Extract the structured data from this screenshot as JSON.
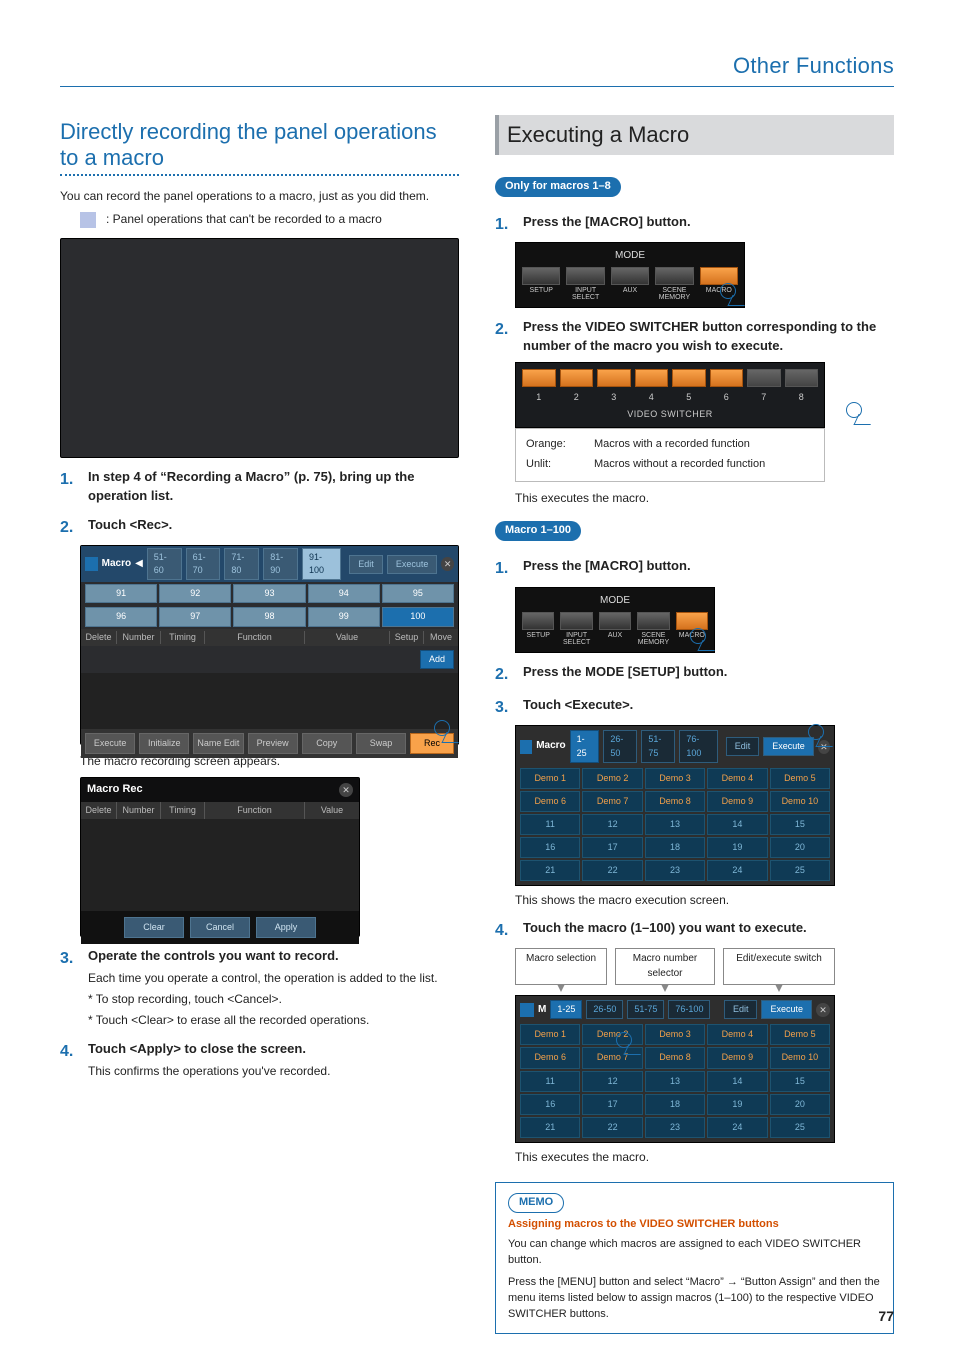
{
  "page_number": "77",
  "header": "Other Functions",
  "left": {
    "title": "Directly recording the panel operations to a macro",
    "intro": "You can record the panel operations to a macro, just as you did them.",
    "swatch_caption": ": Panel operations that can't be recorded to a macro",
    "steps": [
      {
        "num": "1.",
        "title": "In step 4 of “Recording a Macro” (p. 75), bring up the operation list."
      },
      {
        "num": "2.",
        "title": "Touch <Rec>."
      }
    ],
    "macro_list": {
      "title": "Macro",
      "arrow": "◀",
      "tabs": [
        "51-60",
        "61-70",
        "71-80",
        "81-90",
        "91-100"
      ],
      "active_tab": "91-100",
      "right_pill": "Edit",
      "right_pill2": "Execute",
      "cells_row1": [
        "91",
        "92",
        "93",
        "94",
        "95"
      ],
      "cells_row2": [
        "96",
        "97",
        "98",
        "99",
        "100"
      ],
      "cols": {
        "delete": "Delete",
        "number": "Number",
        "timing": "Timing",
        "function": "Function",
        "value": "Value",
        "setup": "Setup",
        "move": "Move"
      },
      "add_label": "Add",
      "footer": [
        "Execute",
        "Initialize",
        "Name Edit",
        "Preview",
        "Copy",
        "Swap",
        "Rec"
      ]
    },
    "after_macro_list": "The macro recording screen appears.",
    "macro_rec": {
      "title": "Macro Rec",
      "cols": {
        "delete": "Delete",
        "number": "Number",
        "timing": "Timing",
        "function": "Function",
        "value": "Value"
      },
      "footer": [
        "Clear",
        "Cancel",
        "Apply"
      ]
    },
    "step3": {
      "num": "3.",
      "title": "Operate the controls you want to record.",
      "sub": "Each time you operate a control, the operation is added to the list.",
      "b1": "*  To stop recording, touch <Cancel>.",
      "b2": "*  Touch <Clear> to erase all the recorded operations."
    },
    "step4": {
      "num": "4.",
      "title": "Touch <Apply> to close the screen.",
      "sub": "This confirms the operations you've recorded."
    }
  },
  "right": {
    "title": "Executing a Macro",
    "pill_a": "Only for macros 1–8",
    "a_steps": [
      {
        "num": "1.",
        "title": "Press the [MACRO] button."
      },
      {
        "num": "2.",
        "title": "Press the VIDEO SWITCHER button corresponding to the number of the macro you wish to execute."
      }
    ],
    "mode_panel": {
      "title": "MODE",
      "buttons": [
        "SETUP",
        "INPUT SELECT",
        "AUX",
        "SCENE MEMORY",
        "MACRO"
      ]
    },
    "switcher": {
      "numbers": [
        "1",
        "2",
        "3",
        "4",
        "5",
        "6",
        "7",
        "8"
      ],
      "sub": "VIDEO SWITCHER"
    },
    "legend": {
      "orange_k": "Orange:",
      "orange_v": "Macros with a recorded function",
      "unlit_k": "Unlit:",
      "unlit_v": "Macros without a recorded function"
    },
    "a_after": "This executes the macro.",
    "pill_b": "Macro 1–100",
    "b_steps": [
      {
        "num": "1.",
        "title": "Press the [MACRO] button."
      },
      {
        "num": "2.",
        "title": "Press the MODE [SETUP] button."
      },
      {
        "num": "3.",
        "title": "Touch <Execute>."
      }
    ],
    "macro_exec": {
      "title": "Macro",
      "tabs": [
        "1-25",
        "26-50",
        "51-75",
        "76-100"
      ],
      "active_tab": "1-25",
      "edit": "Edit",
      "execute": "Execute",
      "rows": [
        [
          "Demo 1",
          "Demo 2",
          "Demo 3",
          "Demo 4",
          "Demo 5"
        ],
        [
          "Demo 6",
          "Demo 7",
          "Demo 8",
          "Demo 9",
          "Demo 10"
        ],
        [
          "11",
          "12",
          "13",
          "14",
          "15"
        ],
        [
          "16",
          "17",
          "18",
          "19",
          "20"
        ],
        [
          "21",
          "22",
          "23",
          "24",
          "25"
        ]
      ]
    },
    "b3_after": "This shows the macro execution screen.",
    "b_step4": {
      "num": "4.",
      "title": "Touch the macro (1–100) you want to execute."
    },
    "annos": {
      "sel": "Macro selection",
      "numsel": "Macro number selector",
      "switch": "Edit/execute switch"
    },
    "b4_after": "This executes the macro.",
    "memo": {
      "badge": "MEMO",
      "heading": "Assigning macros to the VIDEO SWITCHER buttons",
      "p1": "You can change which macros are assigned to each VIDEO SWITCHER button.",
      "p2": "Press the [MENU] button and select “Macro” → “Button Assign” and then the menu items listed below to assign macros (1–100) to the respective VIDEO SWITCHER buttons."
    }
  }
}
